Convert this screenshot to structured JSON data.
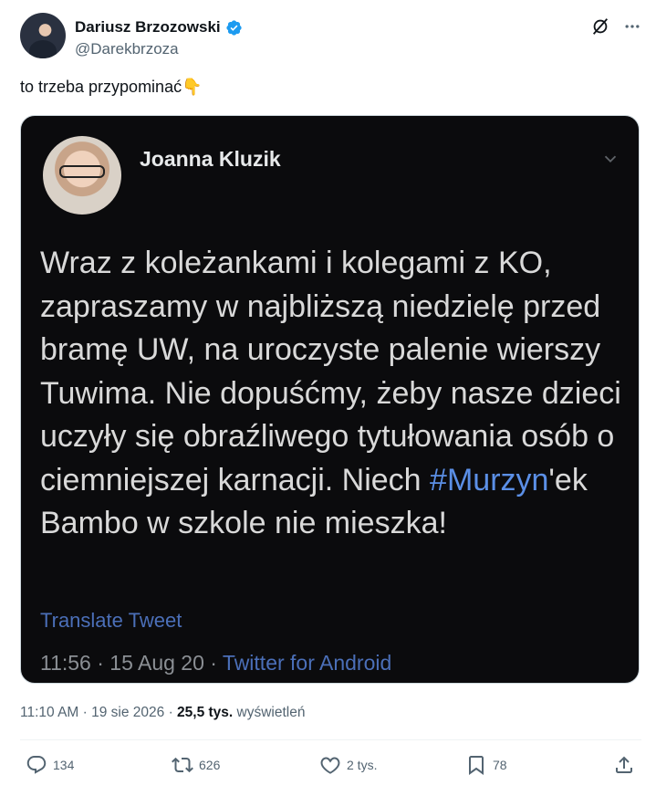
{
  "author": {
    "display_name": "Dariusz Brzozowski",
    "handle": "@Darekbrzoza"
  },
  "tweet": {
    "text": "to trzeba przypominać",
    "emoji": "👇"
  },
  "embedded": {
    "author_name": "Joanna Kluzik",
    "text_before": "Wraz z koleżankami i kolegami z KO, zapraszamy w najbliższą niedzielę przed bramę UW, na uroczyste palenie wierszy Tuwima. Nie dopuśćmy, żeby nasze dzieci uczyły się obraźliwego tytułowania osób o ciemniejszej karnacji. Niech ",
    "hashtag": "#Murzyn",
    "text_after": "'ek Bambo w szkole nie mieszka!",
    "translate_label": "Translate Tweet",
    "meta_time": "11:56 · 15 Aug 20 · ",
    "meta_app": "Twitter for Android"
  },
  "timestamp": {
    "time": "11:10 AM · 19 sie 2026 · ",
    "views_count": "25,5 tys.",
    "views_label": " wyświetleń"
  },
  "actions": {
    "replies": "134",
    "reposts": "626",
    "likes": "2 tys.",
    "bookmarks": "78"
  },
  "colors": {
    "verified": "#1d9bf0",
    "link_in_image": "#5b8fe6"
  },
  "icons": [
    "verified-badge-icon",
    "grok-icon",
    "more-icon",
    "chevron-down-icon",
    "reply-icon",
    "repost-icon",
    "like-icon",
    "bookmark-icon",
    "share-icon"
  ]
}
